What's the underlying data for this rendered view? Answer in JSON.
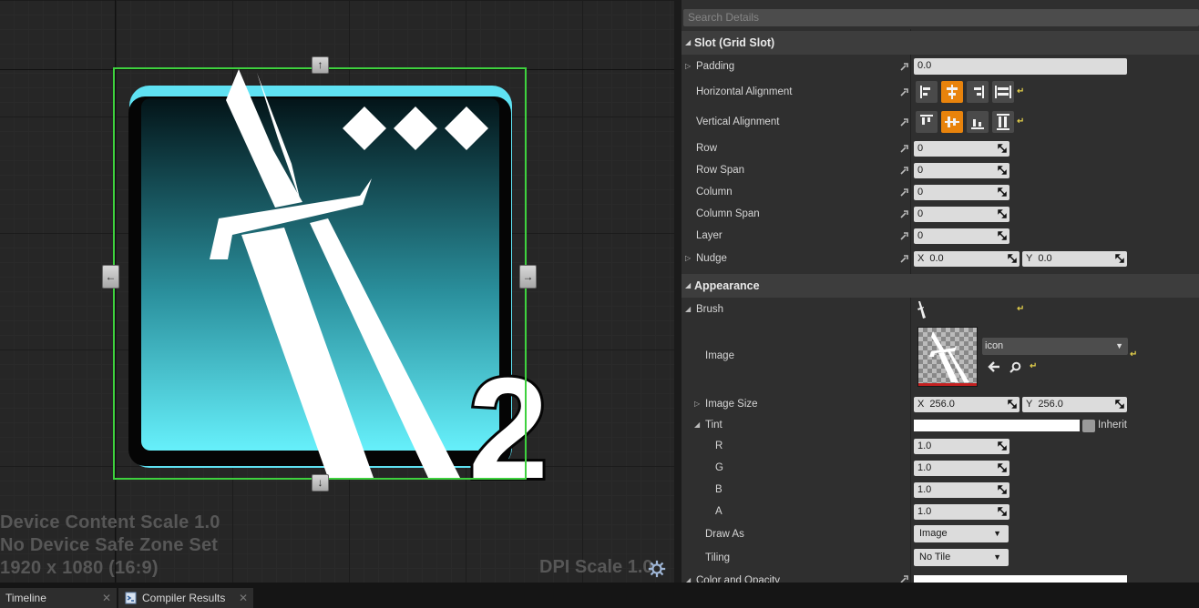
{
  "viewport": {
    "overlay_lines": [
      "Device Content Scale 1.0",
      "No Device Safe Zone Set",
      "1920 x 1080 (16:9)"
    ],
    "dpi_scale": "DPI Scale 1.0",
    "widget_number": "2"
  },
  "details": {
    "search_placeholder": "Search Details",
    "slot": {
      "title": "Slot (Grid Slot)",
      "padding_label": "Padding",
      "padding_value": "0.0",
      "h_align_label": "Horizontal Alignment",
      "v_align_label": "Vertical Alignment",
      "row_label": "Row",
      "row_value": "0",
      "row_span_label": "Row Span",
      "row_span_value": "0",
      "column_label": "Column",
      "column_value": "0",
      "column_span_label": "Column Span",
      "column_span_value": "0",
      "layer_label": "Layer",
      "layer_value": "0",
      "nudge_label": "Nudge",
      "nudge_x_prefix": "X",
      "nudge_x": "0.0",
      "nudge_y_prefix": "Y",
      "nudge_y": "0.0"
    },
    "appearance": {
      "title": "Appearance",
      "brush_label": "Brush",
      "image_label": "Image",
      "image_asset": "icon",
      "image_size_label": "Image Size",
      "size_x_prefix": "X",
      "size_x": "256.0",
      "size_y_prefix": "Y",
      "size_y": "256.0",
      "tint_label": "Tint",
      "inherit_label": "Inherit",
      "r_label": "R",
      "r_value": "1.0",
      "g_label": "G",
      "g_value": "1.0",
      "b_label": "B",
      "b_value": "1.0",
      "a_label": "A",
      "a_value": "1.0",
      "draw_as_label": "Draw As",
      "draw_as_value": "Image",
      "tiling_label": "Tiling",
      "tiling_value": "No Tile",
      "color_opacity_label": "Color and Opacity"
    }
  },
  "tabs": [
    {
      "label": "Timeline"
    },
    {
      "label": "Compiler Results"
    }
  ],
  "colors": {
    "accent_orange": "#e8830c",
    "selection_green": "#3ed13e",
    "icon_cyan": "#5de6f5"
  }
}
